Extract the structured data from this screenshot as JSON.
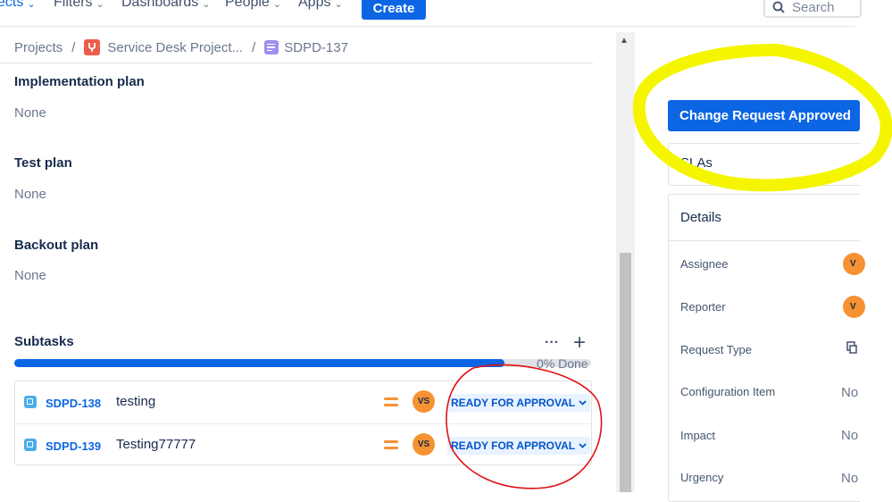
{
  "nav": {
    "items": [
      "ects",
      "Filters",
      "Dashboards",
      "People",
      "Apps"
    ],
    "create_label": "Create",
    "search_placeholder": "Search"
  },
  "breadcrumb": {
    "projects": "Projects",
    "project_name": "Service Desk Project...",
    "issue_key": "SDPD-137"
  },
  "fields": [
    {
      "title": "Implementation plan",
      "value": "None"
    },
    {
      "title": "Test plan",
      "value": "None"
    },
    {
      "title": "Backout plan",
      "value": "None"
    }
  ],
  "subtasks": {
    "title": "Subtasks",
    "more_label": "···",
    "add_label": "+",
    "progress_fraction": 0.85,
    "progress_label": "0% Done",
    "items": [
      {
        "key": "SDPD-138",
        "summary": "testing",
        "assignee_initials": "VS",
        "status": "READY FOR APPROVAL"
      },
      {
        "key": "SDPD-139",
        "summary": "Testing77777",
        "assignee_initials": "VS",
        "status": "READY FOR APPROVAL"
      }
    ]
  },
  "side_panel": {
    "status_button": "Change Request Approved",
    "sla_label": "SLAs",
    "details_header": "Details",
    "details": {
      "assignee_label": "Assignee",
      "assignee_avatar": "V",
      "reporter_label": "Reporter",
      "reporter_avatar": "V",
      "request_type_label": "Request Type",
      "configuration_item_label": "Configuration Item",
      "configuration_item_value": "No",
      "impact_label": "Impact",
      "impact_value": "No",
      "urgency_label": "Urgency",
      "urgency_value": "No"
    }
  },
  "colors": {
    "brand": "#0c66e4",
    "annotation_yellow": "#f5f500",
    "annotation_red": "#e01010",
    "priority": "#f79232"
  }
}
